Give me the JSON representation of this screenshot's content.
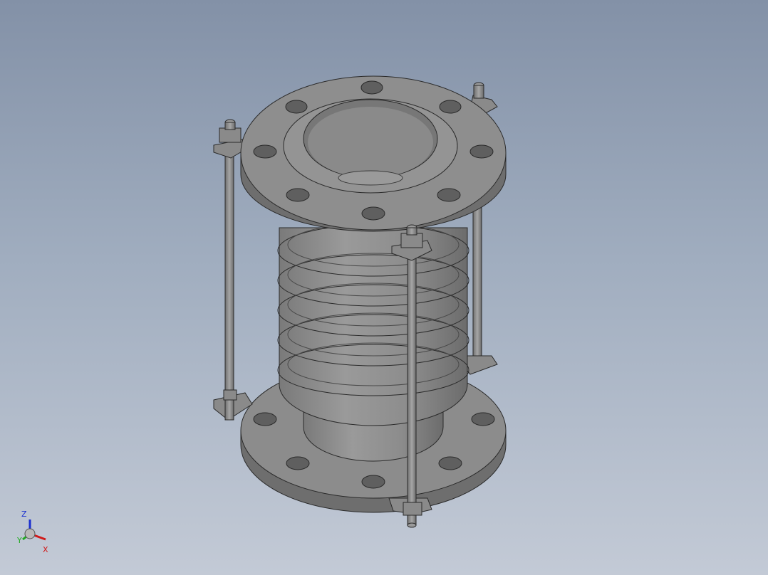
{
  "viewport": {
    "background_top": "#8391a7",
    "background_bottom": "#c3cad6",
    "model_description_icon": "expansion-joint-model"
  },
  "triad": {
    "axes": [
      {
        "label": "Z",
        "color": "#1a2fd0"
      },
      {
        "label": "Y",
        "color": "#1faa1f"
      },
      {
        "label": "X",
        "color": "#d01a1a"
      }
    ]
  },
  "colors": {
    "metal_light": "#9c9c9c",
    "metal_mid": "#8a8a8a",
    "metal_dark": "#6f6f6f",
    "edge": "#2a2a2a"
  }
}
